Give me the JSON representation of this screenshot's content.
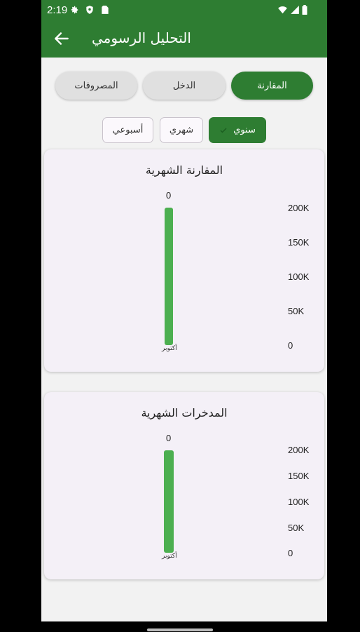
{
  "status_bar": {
    "time": "2:19"
  },
  "app_bar": {
    "title": "التحليل الرسومي"
  },
  "tabs": [
    {
      "label": "المقارنة",
      "active": true
    },
    {
      "label": "الدخل",
      "active": false
    },
    {
      "label": "المصروفات",
      "active": false
    }
  ],
  "periods": [
    {
      "label": "سنوي",
      "active": true
    },
    {
      "label": "شهري",
      "active": false
    },
    {
      "label": "أسبوعي",
      "active": false
    }
  ],
  "colors": {
    "primary": "#2e7d32",
    "bar": "#4caf50"
  },
  "chart_data": [
    {
      "type": "bar",
      "title": "المقارنة الشهرية",
      "categories": [
        "أكتوبر"
      ],
      "values": [
        0
      ],
      "data_labels": [
        "0"
      ],
      "y_ticks": [
        "200K",
        "150K",
        "100K",
        "50K",
        "0"
      ],
      "ylim": [
        0,
        200000
      ]
    },
    {
      "type": "bar",
      "title": "المدخرات الشهرية",
      "categories": [
        "أكتوبر"
      ],
      "values": [
        0
      ],
      "data_labels": [
        "0"
      ],
      "y_ticks": [
        "200K",
        "150K",
        "100K",
        "50K",
        "0"
      ],
      "ylim": [
        0,
        200000
      ]
    }
  ]
}
